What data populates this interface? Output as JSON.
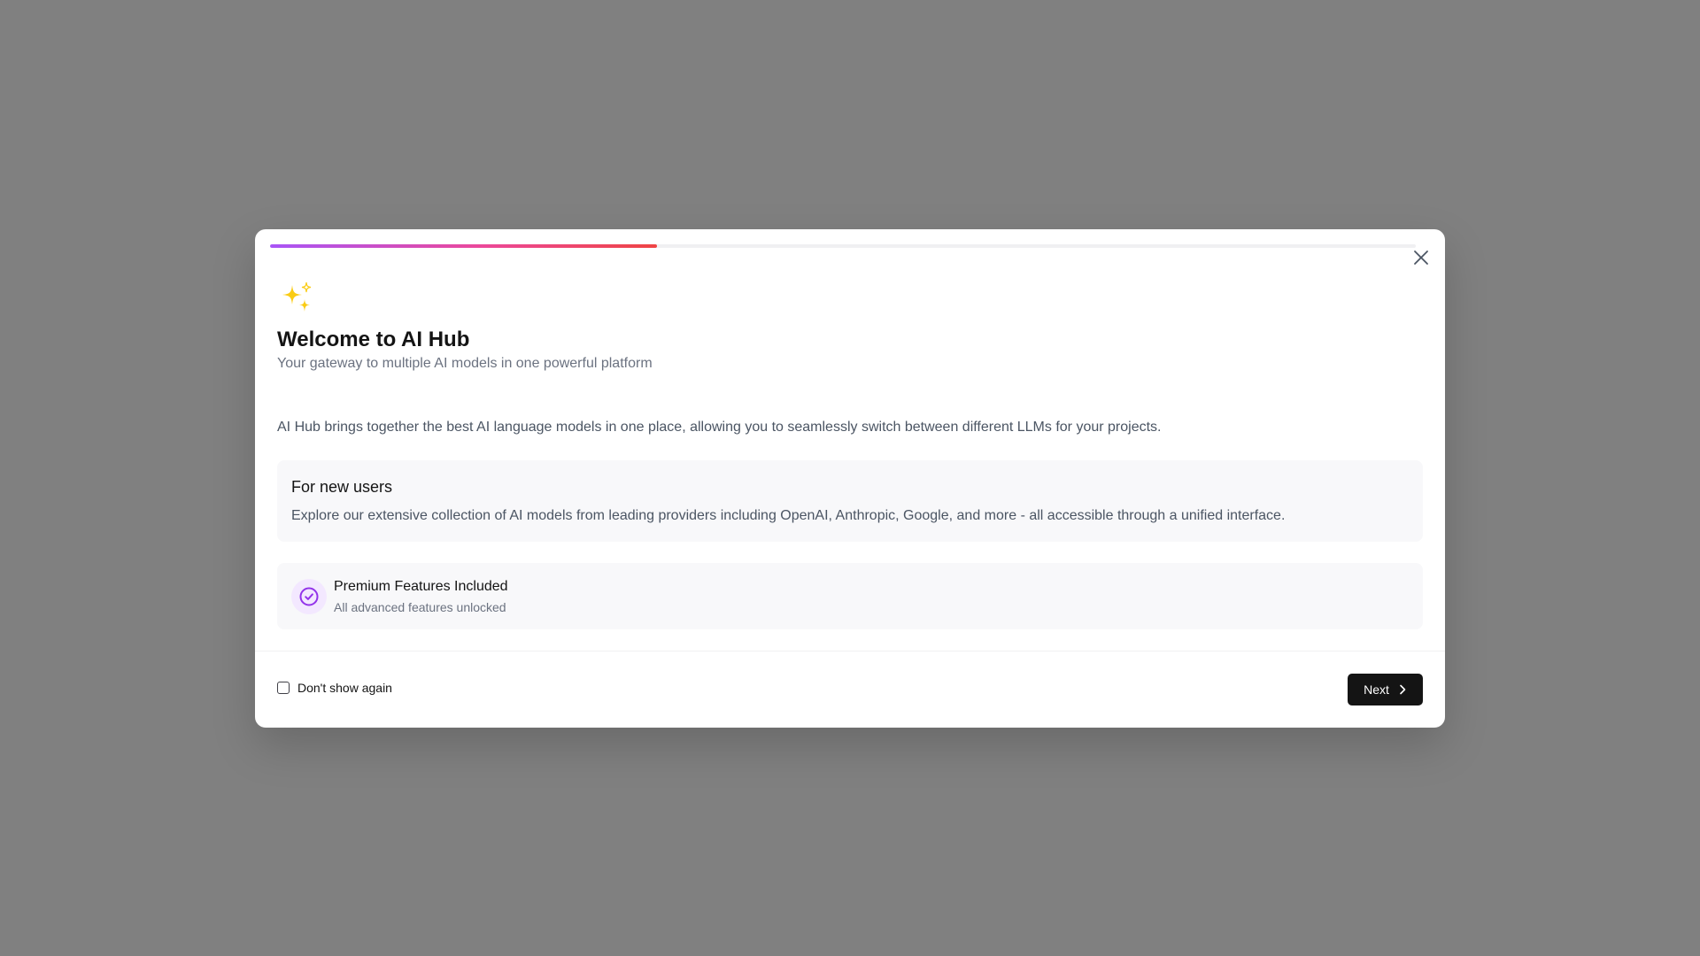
{
  "onboarding": {
    "progress_fraction": 0.338,
    "title": "Welcome to AI Hub",
    "subtitle": "Your gateway to multiple AI models in one powerful platform",
    "intro": "AI Hub brings together the best AI language models in one place, allowing you to seamlessly switch between different LLMs for your projects.",
    "card": {
      "title": "For new users",
      "text": "Explore our extensive collection of AI models from leading providers including OpenAI, Anthropic, Google, and more - all accessible through a unified interface."
    },
    "feature": {
      "icon": "check-circle-icon",
      "title": "Premium Features Included",
      "subtitle": "All advanced features unlocked"
    },
    "footer": {
      "checkbox_label": "Don't show again",
      "checkbox_checked": false,
      "next_label": "Next"
    },
    "icons": {
      "header": "sparkles-icon",
      "close": "close-icon",
      "next": "chevron-right-icon"
    },
    "colors": {
      "overlay": "#808080",
      "progress_start": "#a855f7",
      "progress_mid": "#ec4899",
      "progress_end": "#ef4444",
      "sparkle": "#facc15",
      "feature_icon": "#9333ea",
      "feature_icon_bg": "#f3e8ff",
      "primary_button": "#141414"
    }
  }
}
